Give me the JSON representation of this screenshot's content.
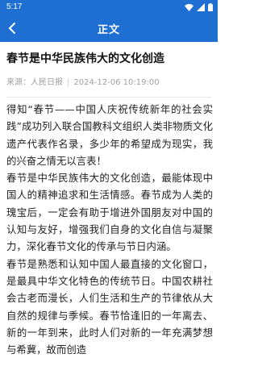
{
  "status_bar": {
    "time": "5:17"
  },
  "app_bar": {
    "title": "正文"
  },
  "article": {
    "title": "春节是中华民族伟大的文化创造",
    "source": "来源：人民日报",
    "date": "2024-12-06 10:19:00",
    "paragraphs": [
      "得知“春节——中国人庆祝传统新年的社会实践”成功列入联合国教科文组织人类非物质文化遗产代表作名录，多少年的希望成为现实，我的兴奋之情无以言表！",
      "春节是中华民族伟大的文化创造，最能体现中国人的精神追求和生活情感。春节成为人类的瑰宝后，一定会有助于增进外国朋友对中国的认知与友好，增强我们自身的文化自信与凝聚力，深化春节文化的传承与节日内涵。",
      "春节是熟悉和认知中国人最直接的文化窗口，是最具中华文化特色的传统节日。中国农耕社会古老而漫长，人们生活和生产的节律依从大自然的规律与季候。春节恰逢旧的一年离去、新的一年到来，此时人们对新的一年充满梦想与希冀，故而创造"
    ]
  },
  "colors": {
    "header": "#1f6fd3",
    "meta_text": "#a0a0a0"
  },
  "icons": [
    "back-arrow-icon",
    "wifi-icon",
    "signal-icon",
    "battery-icon"
  ]
}
